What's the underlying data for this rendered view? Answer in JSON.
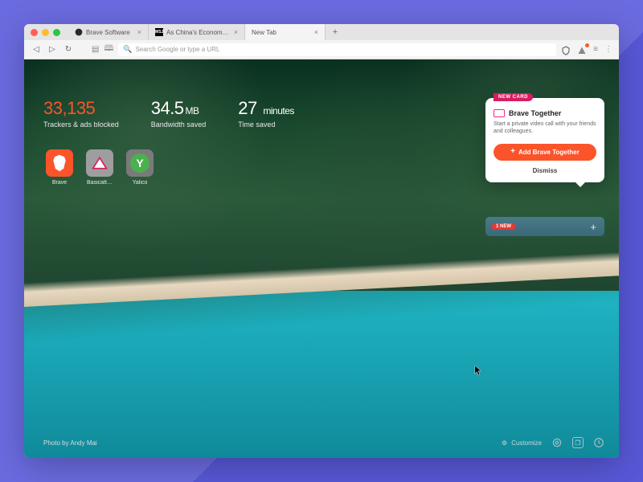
{
  "tabs": [
    {
      "label": "Brave Software",
      "favicon": "github"
    },
    {
      "label": "As China's Economy Suffers, Xi Fi…",
      "favicon": "wsj"
    },
    {
      "label": "New Tab",
      "favicon": ""
    }
  ],
  "toolbar": {
    "search_placeholder": "Search Google or type a URL"
  },
  "stats": {
    "trackers": {
      "value": "33,135",
      "label": "Trackers & ads blocked"
    },
    "bandwidth": {
      "value": "34.5",
      "unit": "MB",
      "label": "Bandwidth saved"
    },
    "time": {
      "value": "27",
      "unit": "minutes",
      "label": "Time saved"
    }
  },
  "topsites": [
    {
      "name": "Brave",
      "letter": ""
    },
    {
      "name": "Basicatt…",
      "letter": ""
    },
    {
      "name": "Yalico",
      "letter": "Y"
    }
  ],
  "card": {
    "tag": "NEW CARD",
    "title": "Brave Together",
    "desc": "Start a private video call with your friends and colleagues.",
    "add_label": "Add Brave Together",
    "dismiss_label": "Dismiss"
  },
  "card_bar": {
    "badge": "1 NEW"
  },
  "credit": "Photo by Andy Mai",
  "customize_label": "Customize"
}
